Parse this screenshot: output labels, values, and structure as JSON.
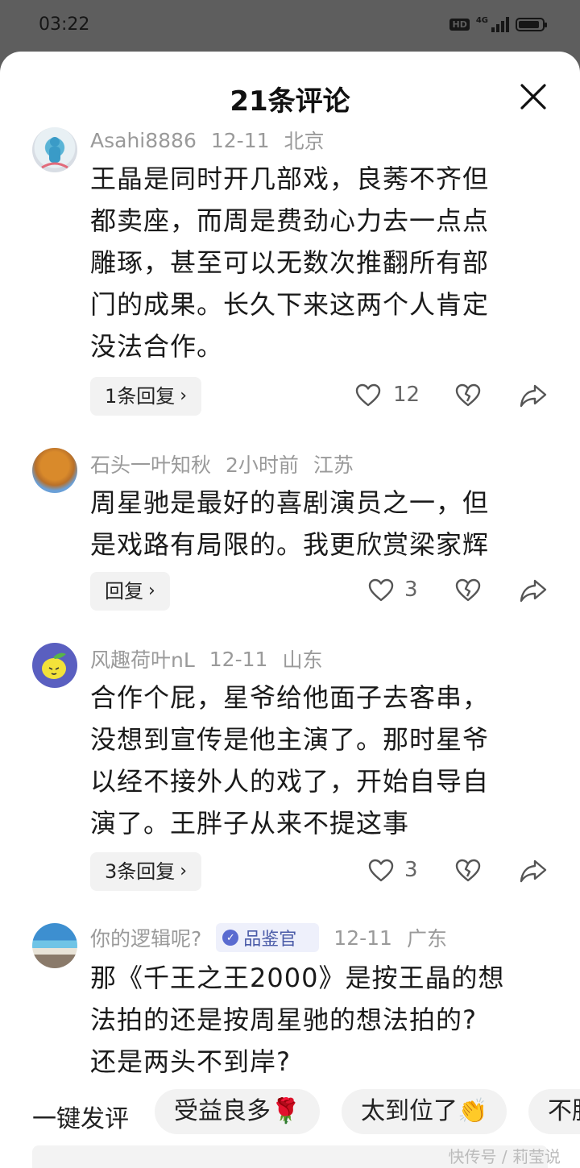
{
  "status_bar": {
    "time": "03:22",
    "hd": "HD",
    "network": "4G",
    "battery_level": 0.9
  },
  "sheet": {
    "title": "21条评论",
    "close_icon": "close-icon"
  },
  "comments": [
    {
      "user": "Asahi8886",
      "date": "12-11",
      "location": "北京",
      "lines": [
        "王晶是同时开几部戏，良莠不齐但",
        "都卖座，而周是费劲心力去一点点",
        "雕琢，甚至可以无数次推翻所有部",
        "门的成果。长久下来这两个人肯定",
        "没法合作。"
      ],
      "reply_label": "1条回复",
      "likes": "12"
    },
    {
      "user": "石头一叶知秋",
      "date": "2小时前",
      "location": "江苏",
      "lines": [
        "周星驰是最好的喜剧演员之一，但",
        "是戏路有局限的。我更欣赏梁家辉"
      ],
      "reply_label": "回复",
      "likes": "3"
    },
    {
      "user": "风趣荷叶nL",
      "date": "12-11",
      "location": "山东",
      "lines": [
        "合作个屁，星爷给他面子去客串，",
        "没想到宣传是他主演了。那时星爷",
        "以经不接外人的戏了，开始自导自",
        "演了。王胖子从来不提这事"
      ],
      "reply_label": "3条回复",
      "likes": "3"
    },
    {
      "user": "你的逻辑呢?",
      "badge": "品鉴官",
      "date": "12-11",
      "location": "广东",
      "lines": [
        "那《千王之王2000》是按王晶的想",
        "法拍的还是按周星驰的想法拍的?",
        "还是两头不到岸?"
      ]
    }
  ],
  "quick_comment": {
    "label": "一键发评",
    "chips": [
      "受益良多🌹",
      "太到位了👏",
      "不胜"
    ]
  },
  "watermark": "快传号 / 莉莹说"
}
